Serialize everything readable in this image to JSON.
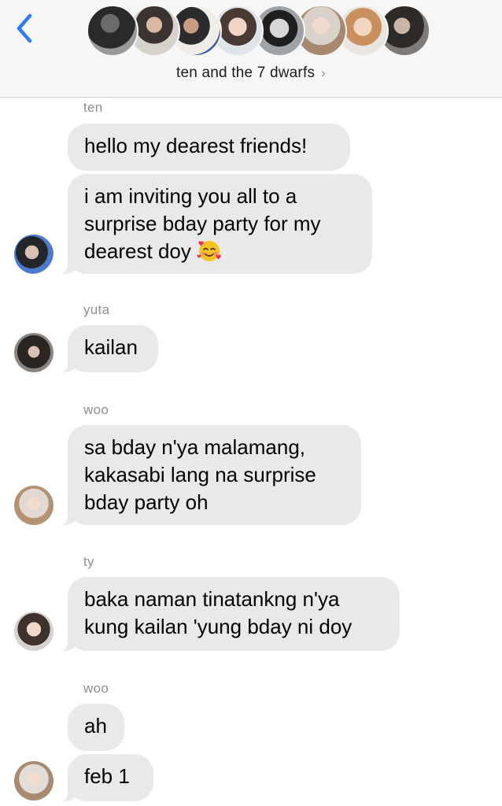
{
  "header": {
    "title": "ten and the 7 dwarfs",
    "title_chevron": "›",
    "back_icon": "chevron-left-icon",
    "group_avatar_count": 8
  },
  "colors": {
    "accent": "#2f7cf6",
    "bubble_received": "#e9e9eb",
    "header_bg": "#f6f6f6",
    "secondary_text": "#8e8e93"
  },
  "messages": [
    {
      "sender": "ten",
      "text": "hello my dearest friends!"
    },
    {
      "text": "i am inviting you all to a\nsurprise bday party for my\ndearest doy",
      "emoji": "smiling-face-with-hearts-emoji"
    },
    {
      "sender": "yuta",
      "text": "kailan"
    },
    {
      "sender": "woo",
      "text": "sa bday n'ya malamang,\nkakasabi lang na surprise\nbday party oh"
    },
    {
      "sender": "ty",
      "text": "baka naman tinatankng n'ya\nkung kailan 'yung bday ni doy"
    },
    {
      "sender": "woo",
      "text": "ah"
    },
    {
      "text": "feb 1"
    }
  ]
}
